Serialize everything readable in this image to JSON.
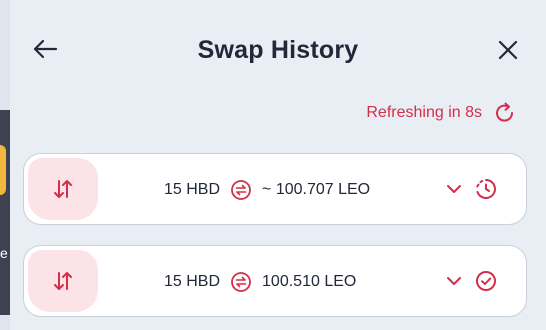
{
  "header": {
    "title": "Swap History"
  },
  "refresh": {
    "text": "Refreshing in 8s"
  },
  "swaps": [
    {
      "from": "15 HBD",
      "to": "~ 100.707 LEO",
      "status_icon": "pending-clock-icon"
    },
    {
      "from": "15 HBD",
      "to": "100.510 LEO",
      "status_icon": "completed-check-icon"
    }
  ],
  "colors": {
    "accent": "#d13048",
    "accent_soft": "#fbe3e7",
    "text": "#212838",
    "background": "#e9eef5",
    "card": "#ffffff"
  }
}
